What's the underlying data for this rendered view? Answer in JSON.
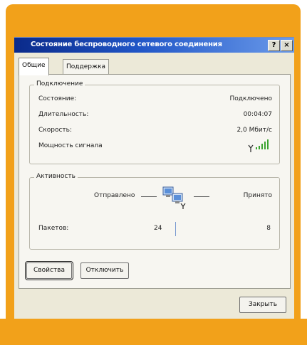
{
  "window": {
    "title": "Состояние беспроводного сетевого соединения",
    "help_btn": "?",
    "close_btn": "×"
  },
  "tabs": [
    {
      "label": "Общие",
      "active": true
    },
    {
      "label": "Поддержка",
      "active": false
    }
  ],
  "connection": {
    "group_title": "Подключение",
    "rows": [
      {
        "label": "Состояние:",
        "value": "Подключено"
      },
      {
        "label": "Длительность:",
        "value": "00:04:07"
      },
      {
        "label": "Скорость:",
        "value": "2,0 Мбит/с"
      },
      {
        "label": "Мощность сигнала",
        "value": ""
      }
    ],
    "signal_bars_filled": 5
  },
  "activity": {
    "group_title": "Активность",
    "sent_label": "Отправлено",
    "received_label": "Принято",
    "packets_label": "Пакетов:",
    "packets_sent": "24",
    "packets_received": "8",
    "icon": "network-computers-icon"
  },
  "buttons": {
    "properties": "Свойства",
    "disable": "Отключить",
    "close": "Закрыть"
  },
  "colors": {
    "frame": "#f2a11a",
    "titlebar_start": "#0a2a8a",
    "titlebar_end": "#6b9bea",
    "dialog_bg": "#ece9d8",
    "signal": "#3aa32f"
  }
}
